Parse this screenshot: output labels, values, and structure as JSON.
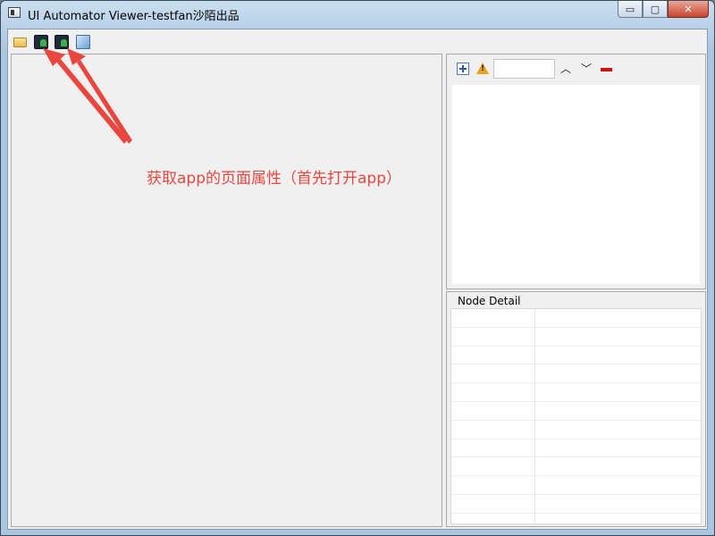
{
  "window": {
    "title": "UI Automator Viewer-testfan沙陌出品",
    "min_label": "▭",
    "max_label": "▢",
    "close_label": "✕"
  },
  "toolbar": {
    "icons": [
      "folder-open-icon",
      "device-screenshot-icon",
      "device-screenshot-compressed-icon",
      "save-icon"
    ]
  },
  "tree_toolbar": {
    "search_value": "",
    "warning_glyph": "!",
    "up_glyph": "︿",
    "down_glyph": "﹀"
  },
  "node_detail": {
    "label": "Node Detail",
    "rows": 12
  },
  "annotation": {
    "text": "获取app的页面属性（首先打开app）",
    "color": "#e8463f"
  }
}
